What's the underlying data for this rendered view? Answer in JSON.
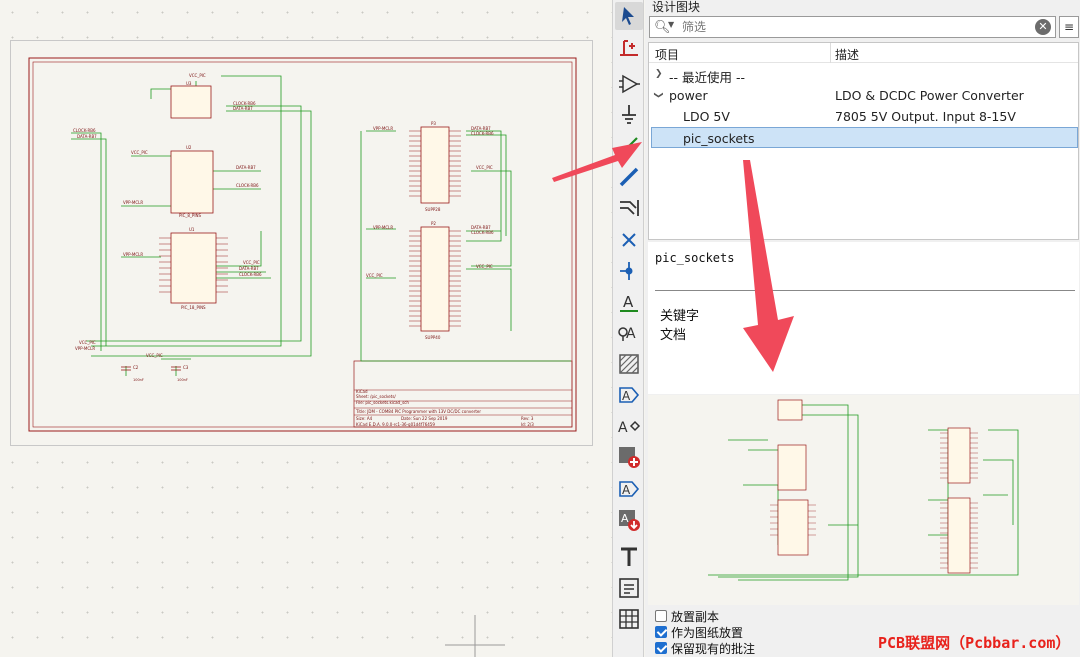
{
  "panel": {
    "title": "设计图块",
    "filter_placeholder": "筛选",
    "clear_icon": "clear-icon",
    "settings_icon": "sort-settings-icon",
    "columns": {
      "item": "项目",
      "description": "描述"
    },
    "rows": [
      {
        "label": "-- 最近使用 --",
        "desc": "",
        "expanded": false,
        "indent": 0
      },
      {
        "label": "power",
        "desc": "LDO & DCDC Power Converter",
        "expanded": true,
        "indent": 0
      },
      {
        "label": "LDO 5V",
        "desc": "7805 5V Output. Input 8-15V",
        "indent": 1
      },
      {
        "label": "pic_sockets",
        "desc": "",
        "indent": 1,
        "selected": true
      }
    ],
    "details": {
      "name": "pic_sockets",
      "keywords_label": "关键字",
      "docs_label": "文档"
    },
    "options": [
      {
        "label": "放置副本",
        "checked": false
      },
      {
        "label": "作为图纸放置",
        "checked": true
      },
      {
        "label": "保留现有的批注",
        "checked": true
      }
    ]
  },
  "schematic": {
    "title_block": {
      "company": "KiCad",
      "sheet_path": "Sheet: /pic_sockets/",
      "file": "File: pic_sockets.kicad_sch",
      "title": "Title: JDM - COM84 PIC Programmer with 13V DC/DC converter",
      "size": "Size: A4",
      "date": "Date: Sun 22 Sep 2019",
      "rev": "Rev: 3",
      "kicad": "KiCad E.D.A. 9.0.0-rc1-36-g01d4f76459",
      "id": "Id: 2/3"
    },
    "labels": {
      "vcc_pic": "VCC_PIC",
      "clock_rb6": "CLOCK-RB6",
      "data_rb7": "DATA-RB7",
      "vpp_mclr": "VPP-MCLR",
      "pic_8_pins": "PIC_8_PINS",
      "pic_18_pins": "PIC_18_PINS",
      "supp28": "SUPP28",
      "supp40": "SUPP40",
      "u1": "U1",
      "u2": "U2",
      "u3": "U3",
      "p2": "P2",
      "p3": "P3",
      "c2": "C2",
      "c3": "C3",
      "c_val": "100nF",
      "c_val2": "100nF"
    }
  },
  "toolbar": {
    "tools": [
      "cursor-icon",
      "local-net-icon",
      "add-symbol-icon",
      "add-power-icon",
      "add-wire-icon",
      "add-bus-icon",
      "bus-entry-icon",
      "no-connect-icon",
      "junction-icon",
      "net-label-icon",
      "global-label-icon",
      "hier-sheet-icon",
      "hier-label-icon",
      "hier-pin-icon",
      "import-sheet-icon",
      "directive-label-icon",
      "add-design-block-icon",
      "add-text-icon",
      "add-textbox-icon",
      "add-table-icon"
    ]
  },
  "watermark": "PCB联盟网（Pcbbar.com）",
  "colors": {
    "wire": "#1f9a1f",
    "symbol": "#9a1b1b",
    "label": "#7a1010",
    "accent_arrow": "#f0495a",
    "selection": "#cde3f7"
  }
}
